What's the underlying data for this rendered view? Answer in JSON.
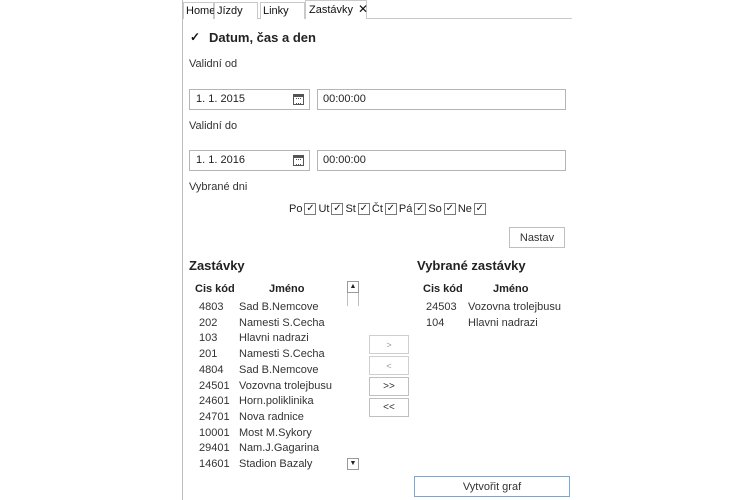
{
  "tabs": [
    {
      "label": "Home"
    },
    {
      "label": "Jízdy"
    },
    {
      "label": "Linky"
    },
    {
      "label": "Zastávky",
      "close": "✕"
    }
  ],
  "section": {
    "title": "Datum, čas a den",
    "checked": true
  },
  "valid_from": {
    "label": "Validní od",
    "date": "1. 1. 2015",
    "time": "00:00:00"
  },
  "valid_to": {
    "label": "Validní do",
    "date": "1. 1. 2016",
    "time": "00:00:00"
  },
  "days_label": "Vybrané dni",
  "days": [
    {
      "label": "Po",
      "checked": true
    },
    {
      "label": "Ut",
      "checked": true
    },
    {
      "label": "St",
      "checked": true
    },
    {
      "label": "Čt",
      "checked": true
    },
    {
      "label": "Pá",
      "checked": true
    },
    {
      "label": "So",
      "checked": true
    },
    {
      "label": "Ne",
      "checked": true
    }
  ],
  "set_button": "Nastav",
  "stops": {
    "title": "Zastávky",
    "col_code": "Cis kód",
    "col_name": "Jméno",
    "rows": [
      {
        "code": "4803",
        "name": "Sad B.Nemcove"
      },
      {
        "code": "202",
        "name": "Namesti S.Cecha"
      },
      {
        "code": "103",
        "name": "Hlavni nadrazi"
      },
      {
        "code": "201",
        "name": "Namesti S.Cecha"
      },
      {
        "code": "4804",
        "name": "Sad B.Nemcove"
      },
      {
        "code": "24501",
        "name": "Vozovna trolejbusu"
      },
      {
        "code": "24601",
        "name": "Horn.poliklinika"
      },
      {
        "code": "24701",
        "name": "Nova radnice"
      },
      {
        "code": "10001",
        "name": "Most M.Sykory"
      },
      {
        "code": "29401",
        "name": "Nam.J.Gagarina"
      },
      {
        "code": "14601",
        "name": "Stadion Bazaly"
      }
    ]
  },
  "selected": {
    "title": "Vybrané zastávky",
    "col_code": "Cis kód",
    "col_name": "Jméno",
    "rows": [
      {
        "code": "24503",
        "name": "Vozovna trolejbusu"
      },
      {
        "code": "104",
        "name": "Hlavni nadrazi"
      }
    ]
  },
  "transfer": {
    "add": ">",
    "remove": "<",
    "add_all": ">>",
    "remove_all": "<<"
  },
  "create_graph": "Vytvořit graf"
}
